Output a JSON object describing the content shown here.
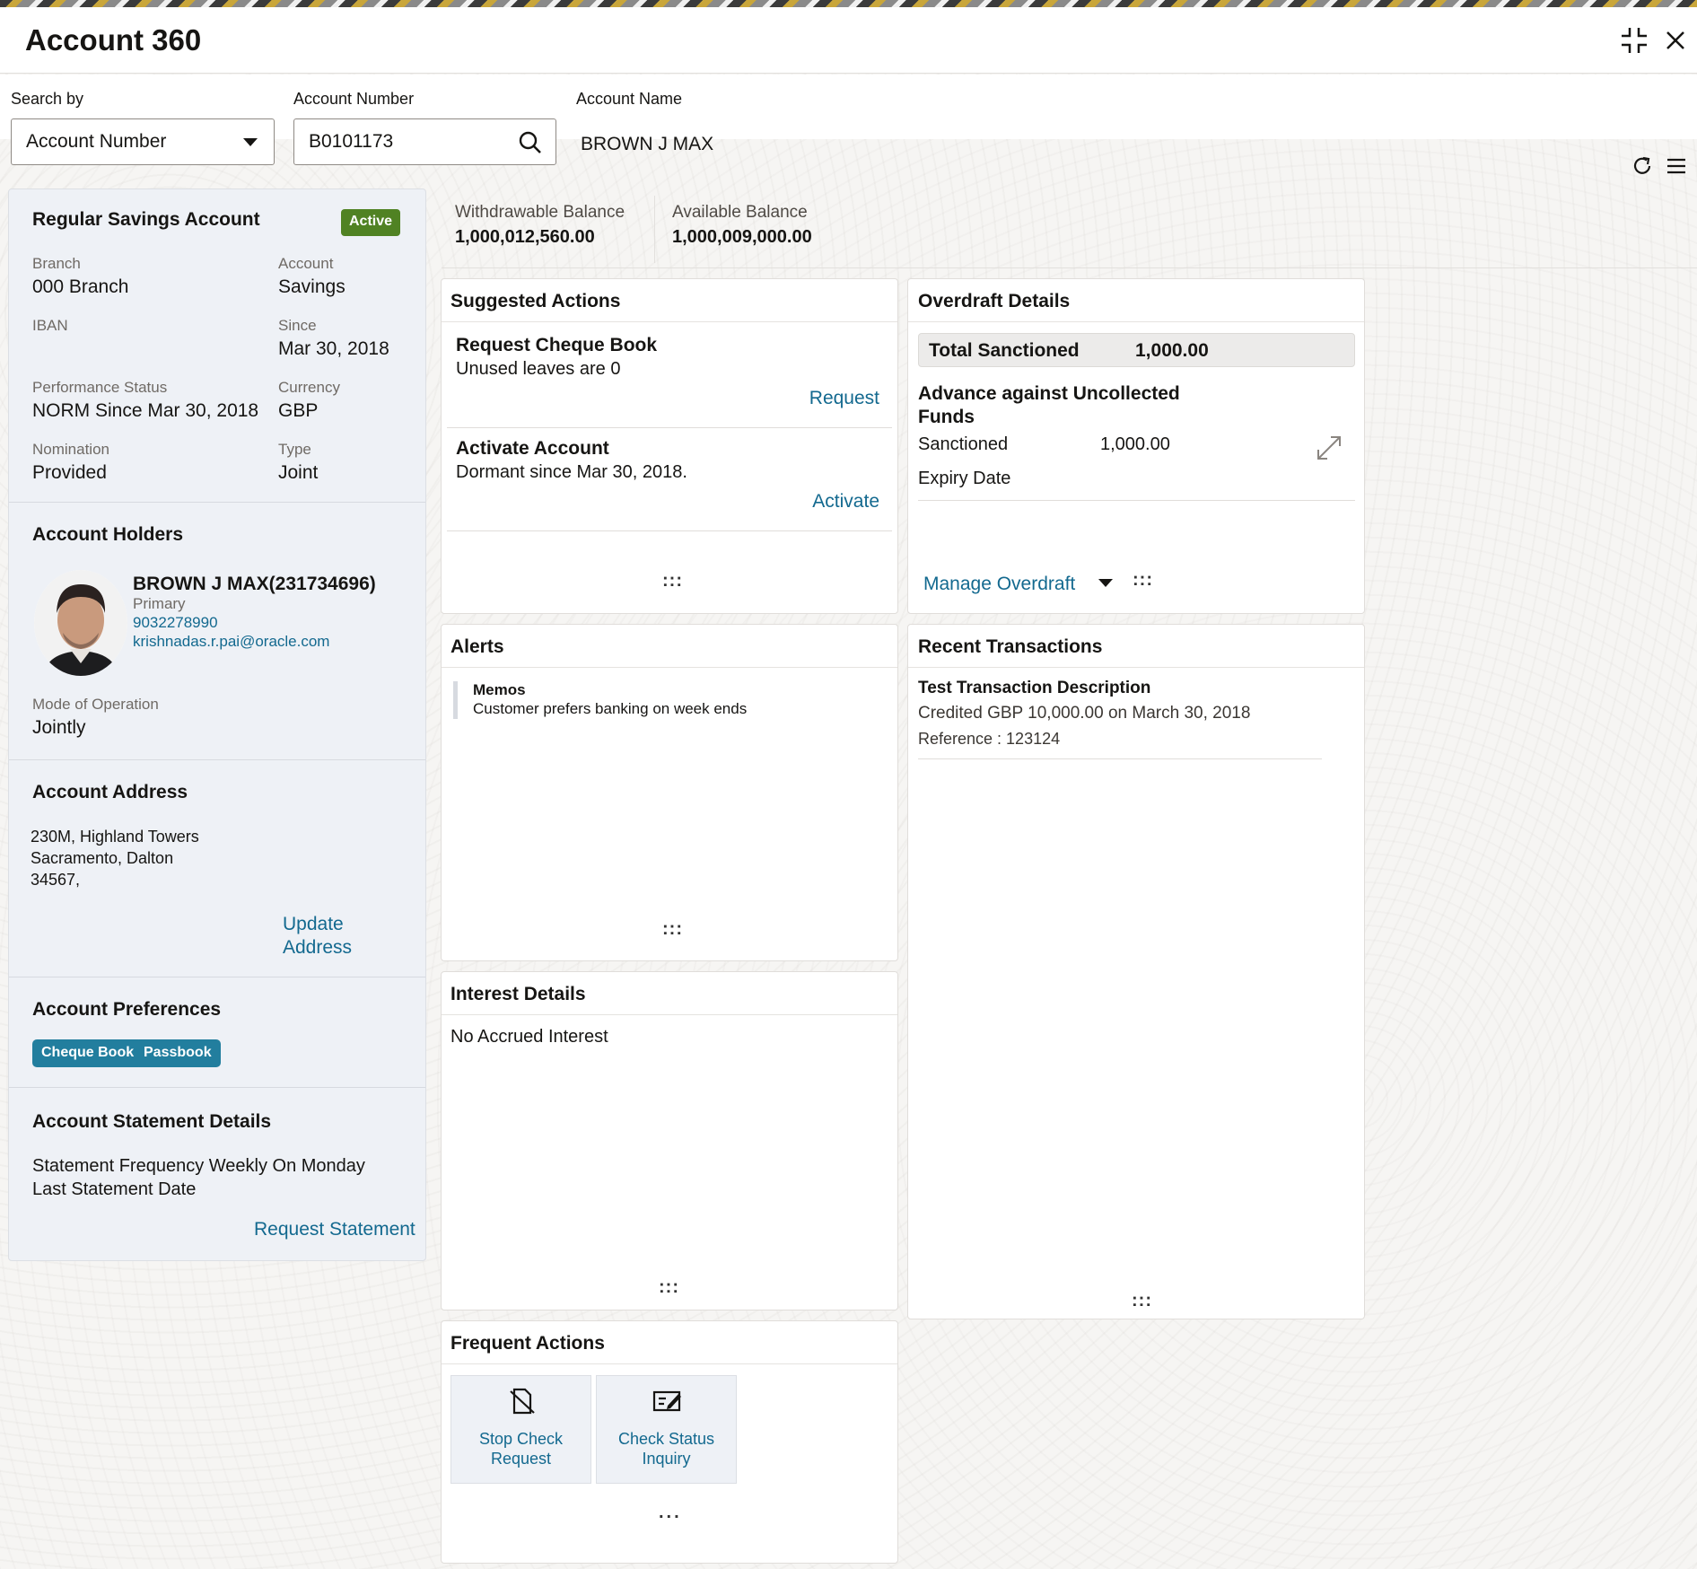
{
  "app": {
    "title": "Account 360"
  },
  "search": {
    "search_by_label": "Search by",
    "search_by_value": "Account Number",
    "account_number_label": "Account Number",
    "account_number_value": "B0101173",
    "account_name_label": "Account Name",
    "account_name_value": "BROWN J MAX"
  },
  "summary": {
    "product": "Regular Savings Account",
    "status": "Active",
    "fields": {
      "branch_label": "Branch",
      "branch_value": "000 Branch",
      "account_label": "Account",
      "account_value": "Savings",
      "iban_label": "IBAN",
      "since_label": "Since",
      "since_value": "Mar 30, 2018",
      "performance_label": "Performance Status",
      "performance_value": "NORM Since Mar 30, 2018",
      "currency_label": "Currency",
      "currency_value": "GBP",
      "nomination_label": "Nomination",
      "nomination_value": "Provided",
      "type_label": "Type",
      "type_value": "Joint"
    }
  },
  "holders": {
    "title": "Account Holders",
    "name": "BROWN J MAX(231734696)",
    "role": "Primary",
    "phone": "9032278990",
    "email": "krishnadas.r.pai@oracle.com",
    "mode_label": "Mode of Operation",
    "mode_value": "Jointly"
  },
  "address": {
    "title": "Account Address",
    "line1": "230M, Highland Towers",
    "line2": "Sacramento, Dalton",
    "line3": "34567,",
    "update_line1": "Update",
    "update_line2": "Address"
  },
  "preferences": {
    "title": "Account Preferences",
    "items": [
      "Cheque Book",
      "Passbook"
    ]
  },
  "statement": {
    "title": "Account Statement Details",
    "frequency": "Statement Frequency Weekly On Monday",
    "last_date": "Last Statement Date",
    "request_link": "Request Statement"
  },
  "balances": {
    "withdrawable_label": "Withdrawable Balance",
    "withdrawable_value": "1,000,012,560.00",
    "available_label": "Available Balance",
    "available_value": "1,000,009,000.00"
  },
  "suggested": {
    "title": "Suggested Actions",
    "items": [
      {
        "title": "Request Cheque Book",
        "sub": "Unused leaves are 0",
        "link": "Request"
      },
      {
        "title": "Activate Account",
        "sub": "Dormant since Mar 30, 2018.",
        "link": "Activate"
      }
    ]
  },
  "overdraft": {
    "title": "Overdraft Details",
    "total_label": "Total Sanctioned",
    "total_value": "1,000.00",
    "advance_title_1": "Advance against Uncollected",
    "advance_title_2": "Funds",
    "sanctioned_label": "Sanctioned",
    "sanctioned_value": "1,000.00",
    "expiry_label": "Expiry Date",
    "manage_link": "Manage Overdraft"
  },
  "alerts": {
    "title": "Alerts",
    "memo_title": "Memos",
    "memo_text": "Customer prefers banking on week ends"
  },
  "transactions": {
    "title": "Recent Transactions",
    "desc": "Test Transaction Description",
    "detail": "Credited GBP 10,000.00 on March 30, 2018",
    "reference": "Reference : 123124"
  },
  "interest": {
    "title": "Interest Details",
    "text": "No Accrued Interest"
  },
  "frequent": {
    "title": "Frequent Actions",
    "tiles": [
      {
        "line1": "Stop Check",
        "line2": "Request"
      },
      {
        "line1": "Check Status",
        "line2": "Inquiry"
      }
    ],
    "more": "..."
  },
  "handle": ":::",
  "colors": {
    "link": "#13698f",
    "active_badge": "#508223",
    "chip": "#227e9e",
    "panel_bg": "#eef1f6"
  }
}
